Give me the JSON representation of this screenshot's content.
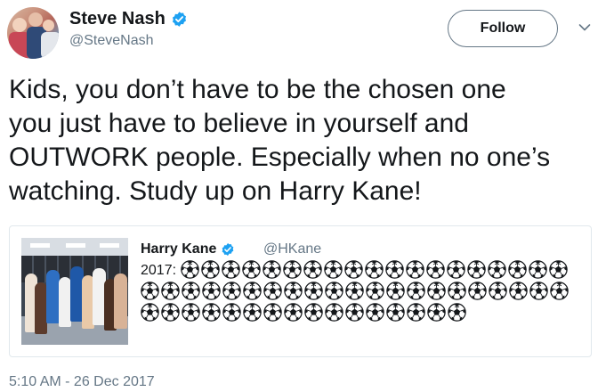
{
  "author": {
    "name": "Steve Nash",
    "handle": "@SteveNash",
    "verified": true,
    "avatar_icon": "profile-photo",
    "follow_label": "Follow"
  },
  "tweet": {
    "text": "Kids, you don’t have to be the chosen one\nyou just have to believe in yourself and\nOUTWORK people. Especially when no one’s\nwatching. Study up on Harry Kane!",
    "timestamp": "5:10 AM - 26 Dec 2017"
  },
  "quoted_tweet": {
    "name": "Harry Kane",
    "handle": "@HKane",
    "verified": true,
    "text_prefix": "2017:",
    "emoji_icon": "soccer-ball-icon",
    "emoji_count": 56,
    "media_icon": "team-locker-room-photo"
  },
  "colors": {
    "verified_blue": "#1da1f2",
    "secondary_text": "#657786",
    "border": "#e1e8ed"
  }
}
